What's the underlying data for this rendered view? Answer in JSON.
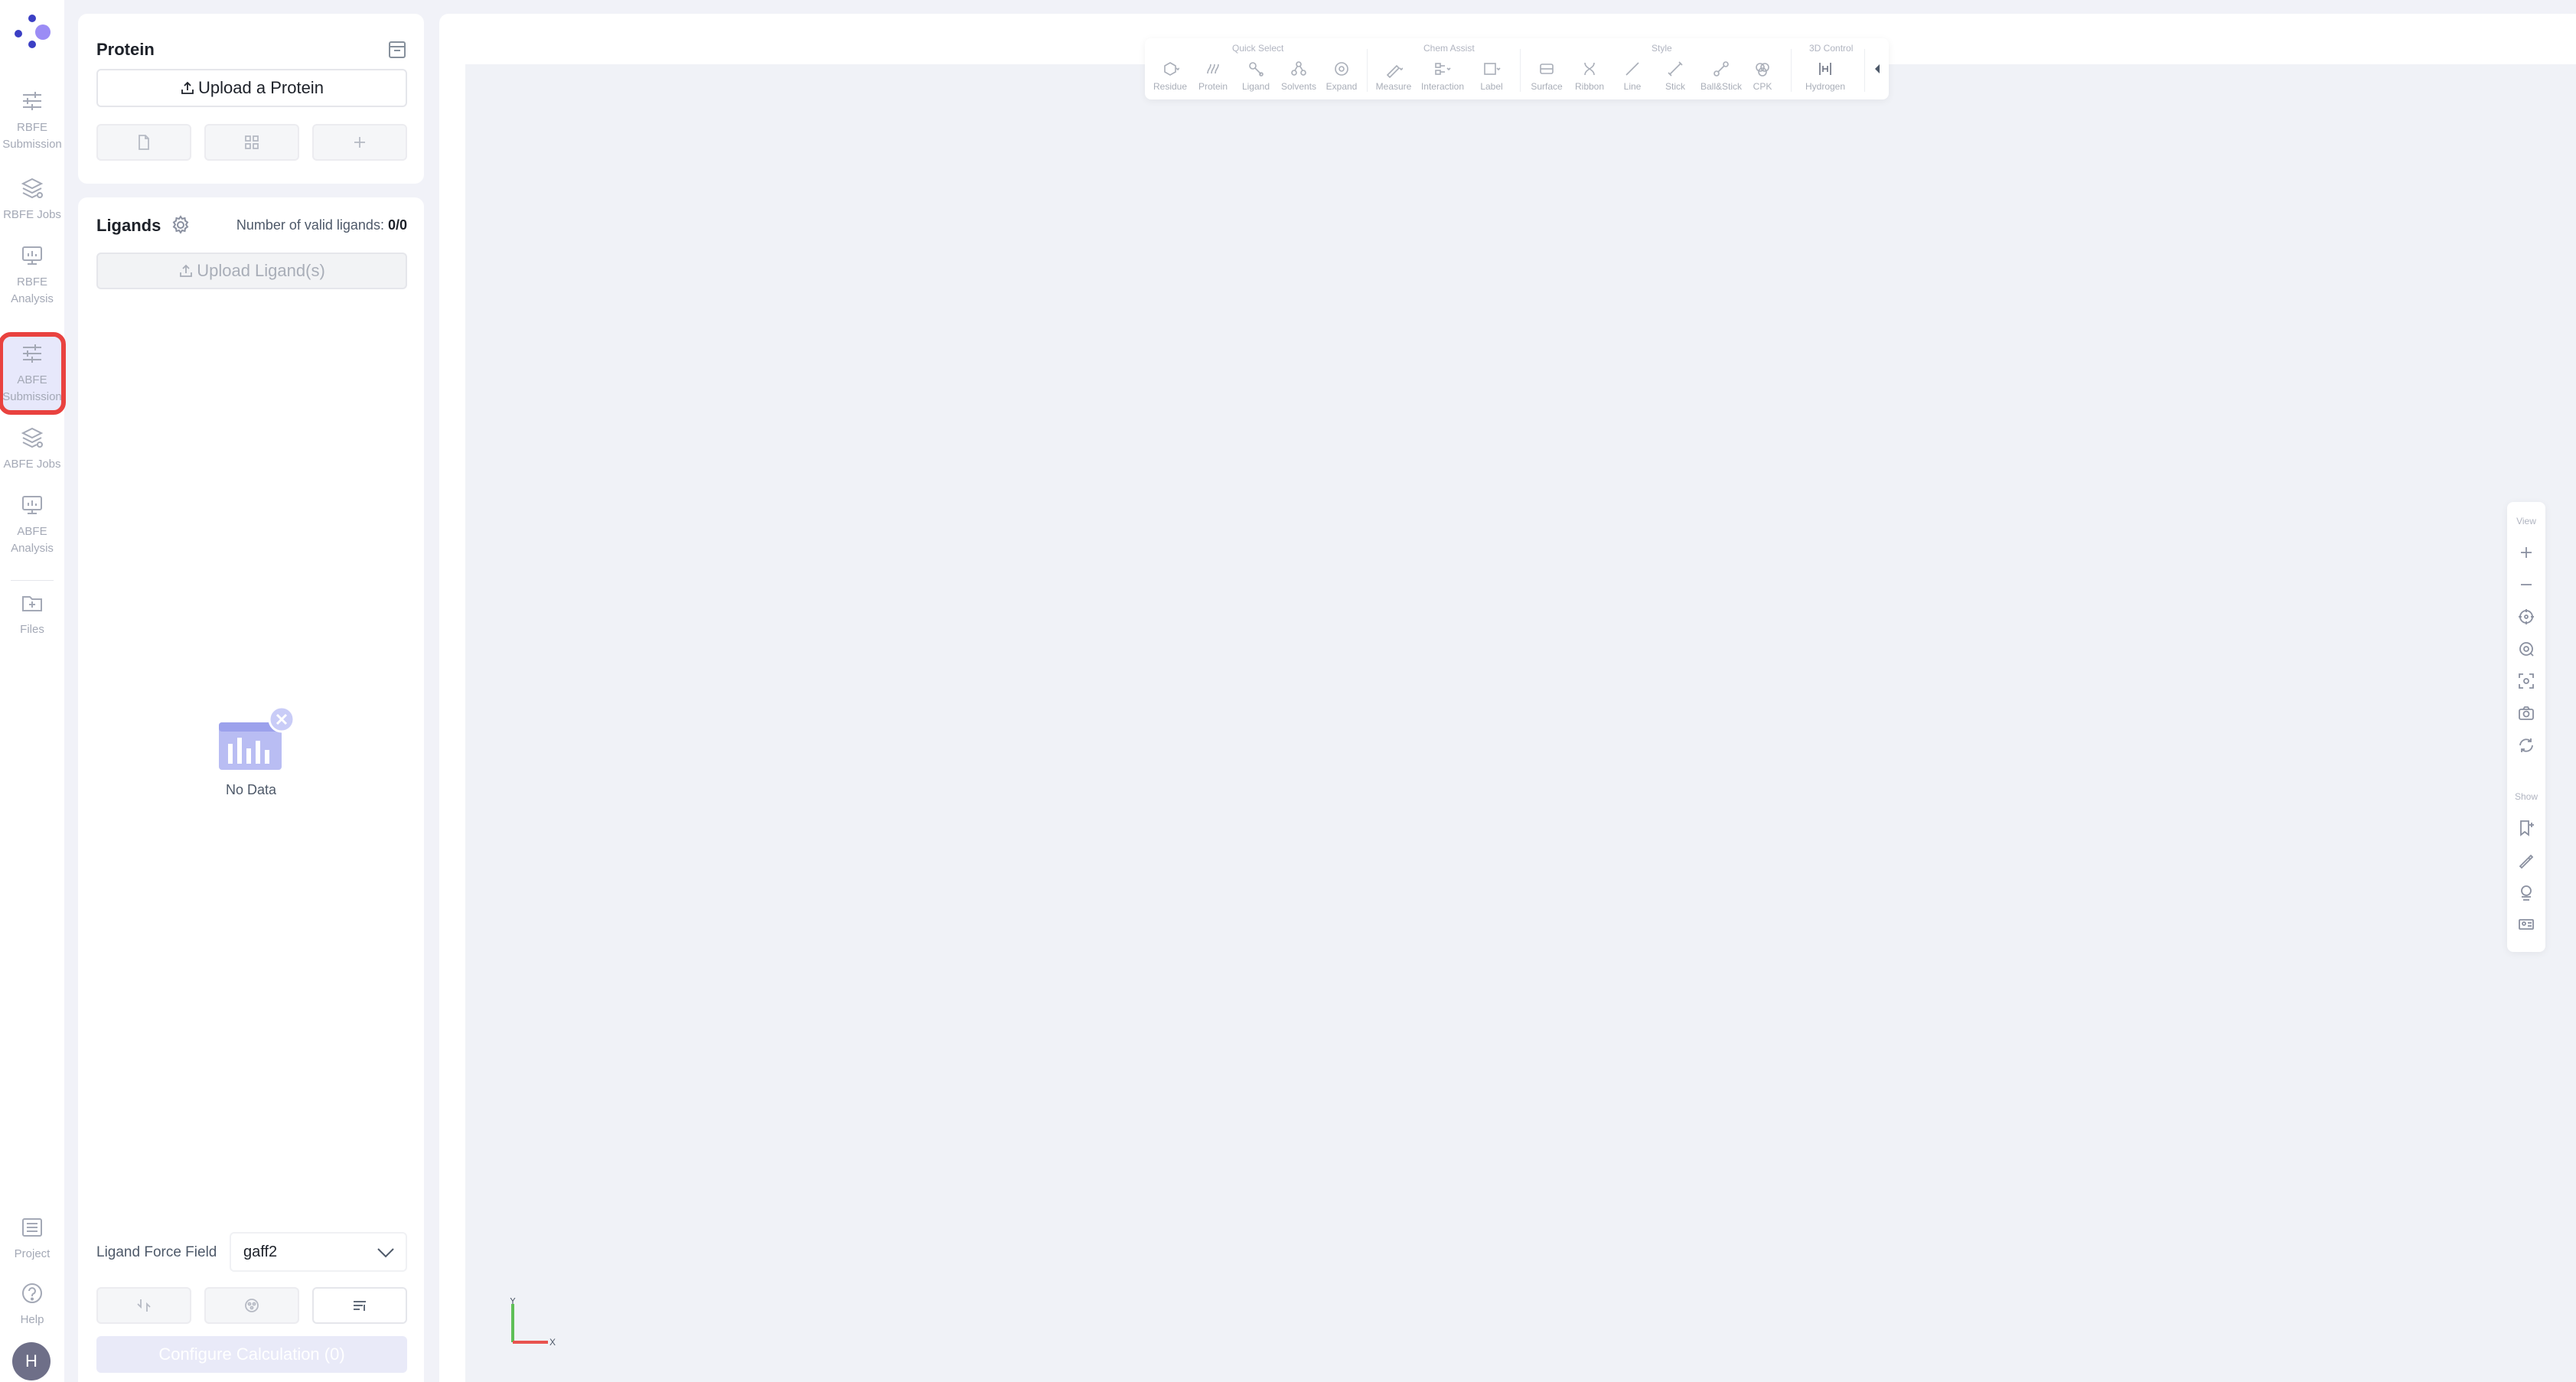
{
  "nav": {
    "items": [
      {
        "label": "RBFE Submission"
      },
      {
        "label": "RBFE Jobs"
      },
      {
        "label": "RBFE Analysis"
      },
      {
        "label": "ABFE Submission"
      },
      {
        "label": "ABFE Jobs"
      },
      {
        "label": "ABFE Analysis"
      },
      {
        "label": "Files"
      }
    ],
    "bottom": [
      {
        "label": "Project"
      },
      {
        "label": "Help"
      }
    ],
    "avatar": "H",
    "active_item": "ABFE Submission",
    "colors": {
      "active_bg": "#e7e8fb",
      "highlight": "#e9423f",
      "brand": "#6e5ff6"
    }
  },
  "protein": {
    "title": "Protein",
    "upload_label": "Upload a Protein"
  },
  "ligands": {
    "title": "Ligands",
    "count_label": "Number of valid ligands:",
    "count_value": "0/0",
    "upload_label": "Upload Ligand(s)",
    "empty_text": "No Data",
    "force_field_label": "Ligand Force Field",
    "force_field_value": "gaff2",
    "configure_label": "Configure Calculation (0)"
  },
  "toolbar": {
    "groups": {
      "quick_select": "Quick Select",
      "chem_assist": "Chem Assist",
      "style": "Style",
      "control_3d": "3D Control"
    },
    "items": {
      "residue": "Residue",
      "protein": "Protein",
      "ligand": "Ligand",
      "solvents": "Solvents",
      "expand": "Expand",
      "measure": "Measure",
      "interaction": "Interaction",
      "label": "Label",
      "surface": "Surface",
      "ribbon": "Ribbon",
      "line": "Line",
      "stick": "Stick",
      "ballstick": "Ball&Stick",
      "cpk": "CPK",
      "hydrogen": "Hydrogen"
    }
  },
  "view_panel": {
    "view_label": "View",
    "show_label": "Show"
  },
  "axes": {
    "y": "Y",
    "x": "X"
  }
}
